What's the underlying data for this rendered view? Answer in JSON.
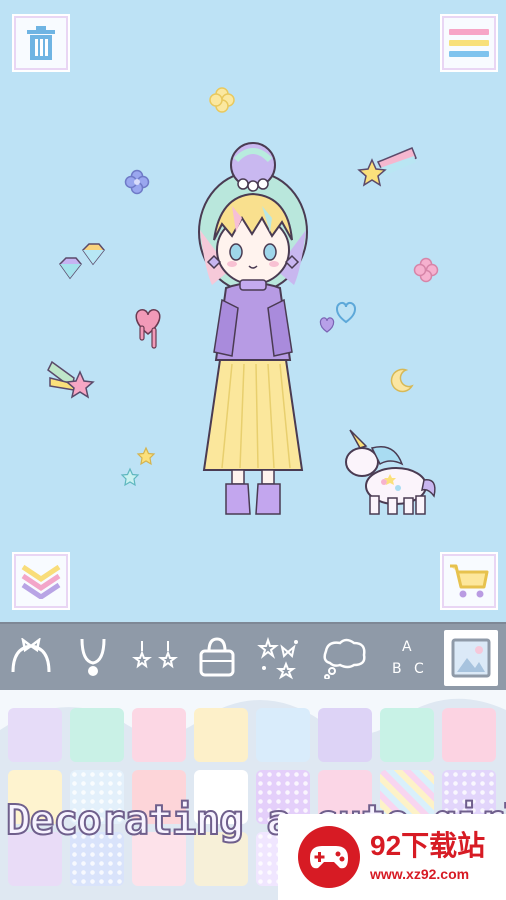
{
  "header": {
    "left_button_icon": "trash-icon",
    "right_button_icon": "menu-icon"
  },
  "stage": {
    "bottom_left_button_icon": "collapse-icon",
    "bottom_right_button_icon": "shopping-cart-icon",
    "stickers": [
      "flower-icon",
      "star-icon",
      "heart-icon",
      "moon-icon",
      "diamond-icon",
      "unicorn-icon"
    ]
  },
  "toolbar": {
    "tabs": [
      {
        "icon": "headband-icon"
      },
      {
        "icon": "necklace-icon"
      },
      {
        "icon": "earrings-icon"
      },
      {
        "icon": "bag-icon"
      },
      {
        "icon": "sparkles-icon"
      },
      {
        "icon": "speech-bubble-icon"
      },
      {
        "icon": "text-icon",
        "letters": [
          "A",
          "B",
          "C"
        ]
      },
      {
        "icon": "background-icon",
        "selected": true
      }
    ]
  },
  "palette": {
    "row1_colors": [
      "#e6dcf8",
      "#c9f1e6",
      "#fcd7e4",
      "#fdf0c9",
      "#d9ecfb",
      "#ddd3f6",
      "#c8f2e6",
      "#fcd3e2"
    ],
    "row2_colors": [
      "#fef3cf",
      "#e3f0fb",
      "#fdd5d9",
      "#ffffff",
      "#e4cffa",
      "#fbd6e6",
      "#f8d5f0",
      "#e2d5fb"
    ],
    "row3_colors": [
      "#e9dcf7",
      "#d9e3fb",
      "#fde2ea",
      "#f7f0d8",
      "#f0e6ff",
      "#dff3fb",
      "#fde4d7",
      "#e6f6ee"
    ]
  },
  "caption": {
    "text": "Decorating a cute girl"
  },
  "watermark": {
    "title": "92下载站",
    "url": "www.xz92.com"
  }
}
